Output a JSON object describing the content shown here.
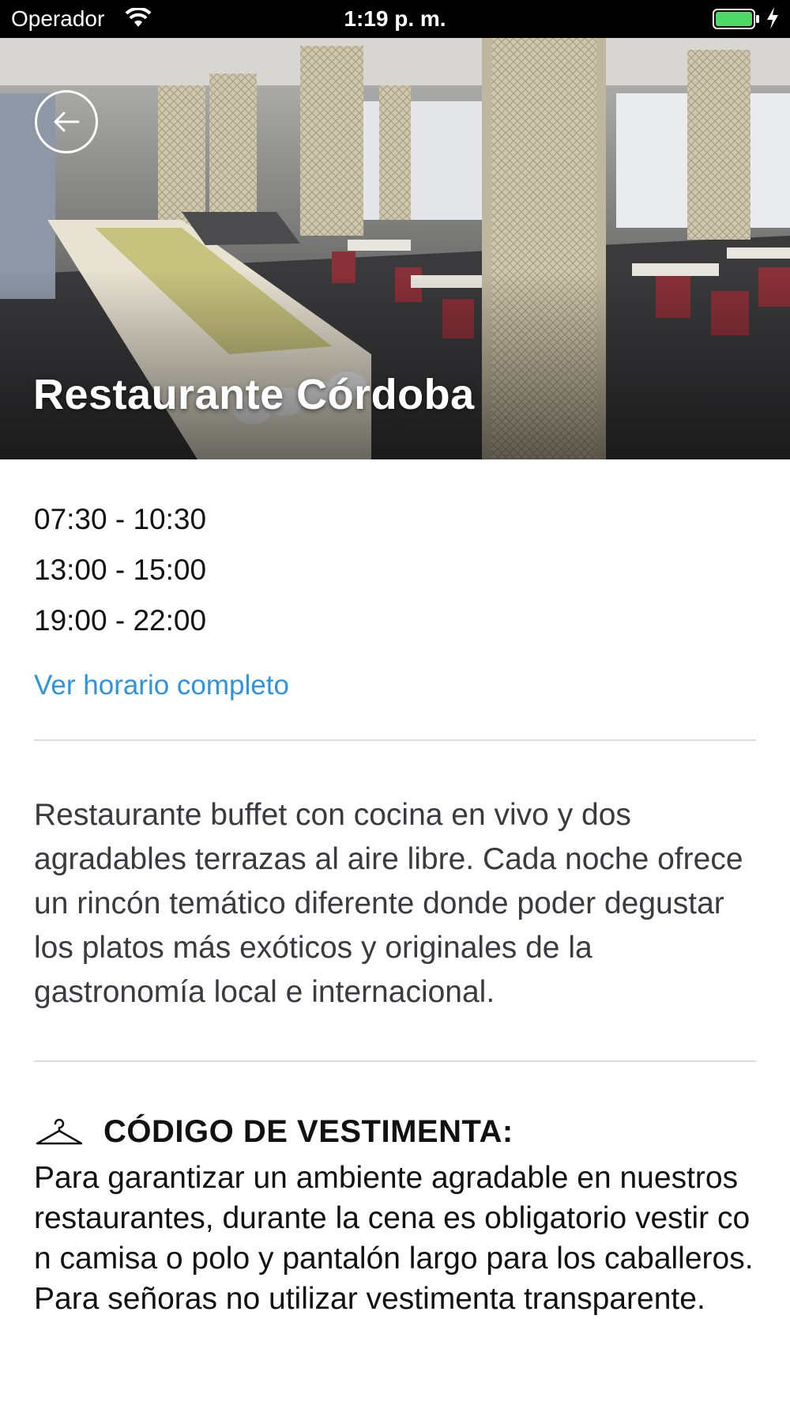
{
  "status_bar": {
    "carrier": "Operador",
    "time": "1:19 p. m.",
    "battery_level": 1.0,
    "battery_color": "#4cd964"
  },
  "hero": {
    "title": "Restaurante Córdoba"
  },
  "schedule": {
    "hours": [
      "07:30 - 10:30",
      "13:00 - 15:00",
      "19:00 - 22:00"
    ],
    "link_label": "Ver horario completo",
    "link_color": "#2b95df"
  },
  "description": "Restaurante buffet con cocina en vivo y dos agradables terrazas al aire libre. Cada noche ofrece un rincón temático diferente donde poder degustar los platos más exóticos y originales de la gastronomía local e internacional.",
  "dress_code": {
    "icon": "hanger-icon",
    "label": "CÓDIGO DE VESTIMENTA:",
    "text": "Para garantizar un ambiente agradable en nuestros restaurantes, durante la cena es obligatorio vestir con camisa o polo y pantalón largo para los caballeros. Para señoras no utilizar vestimenta transparente."
  }
}
